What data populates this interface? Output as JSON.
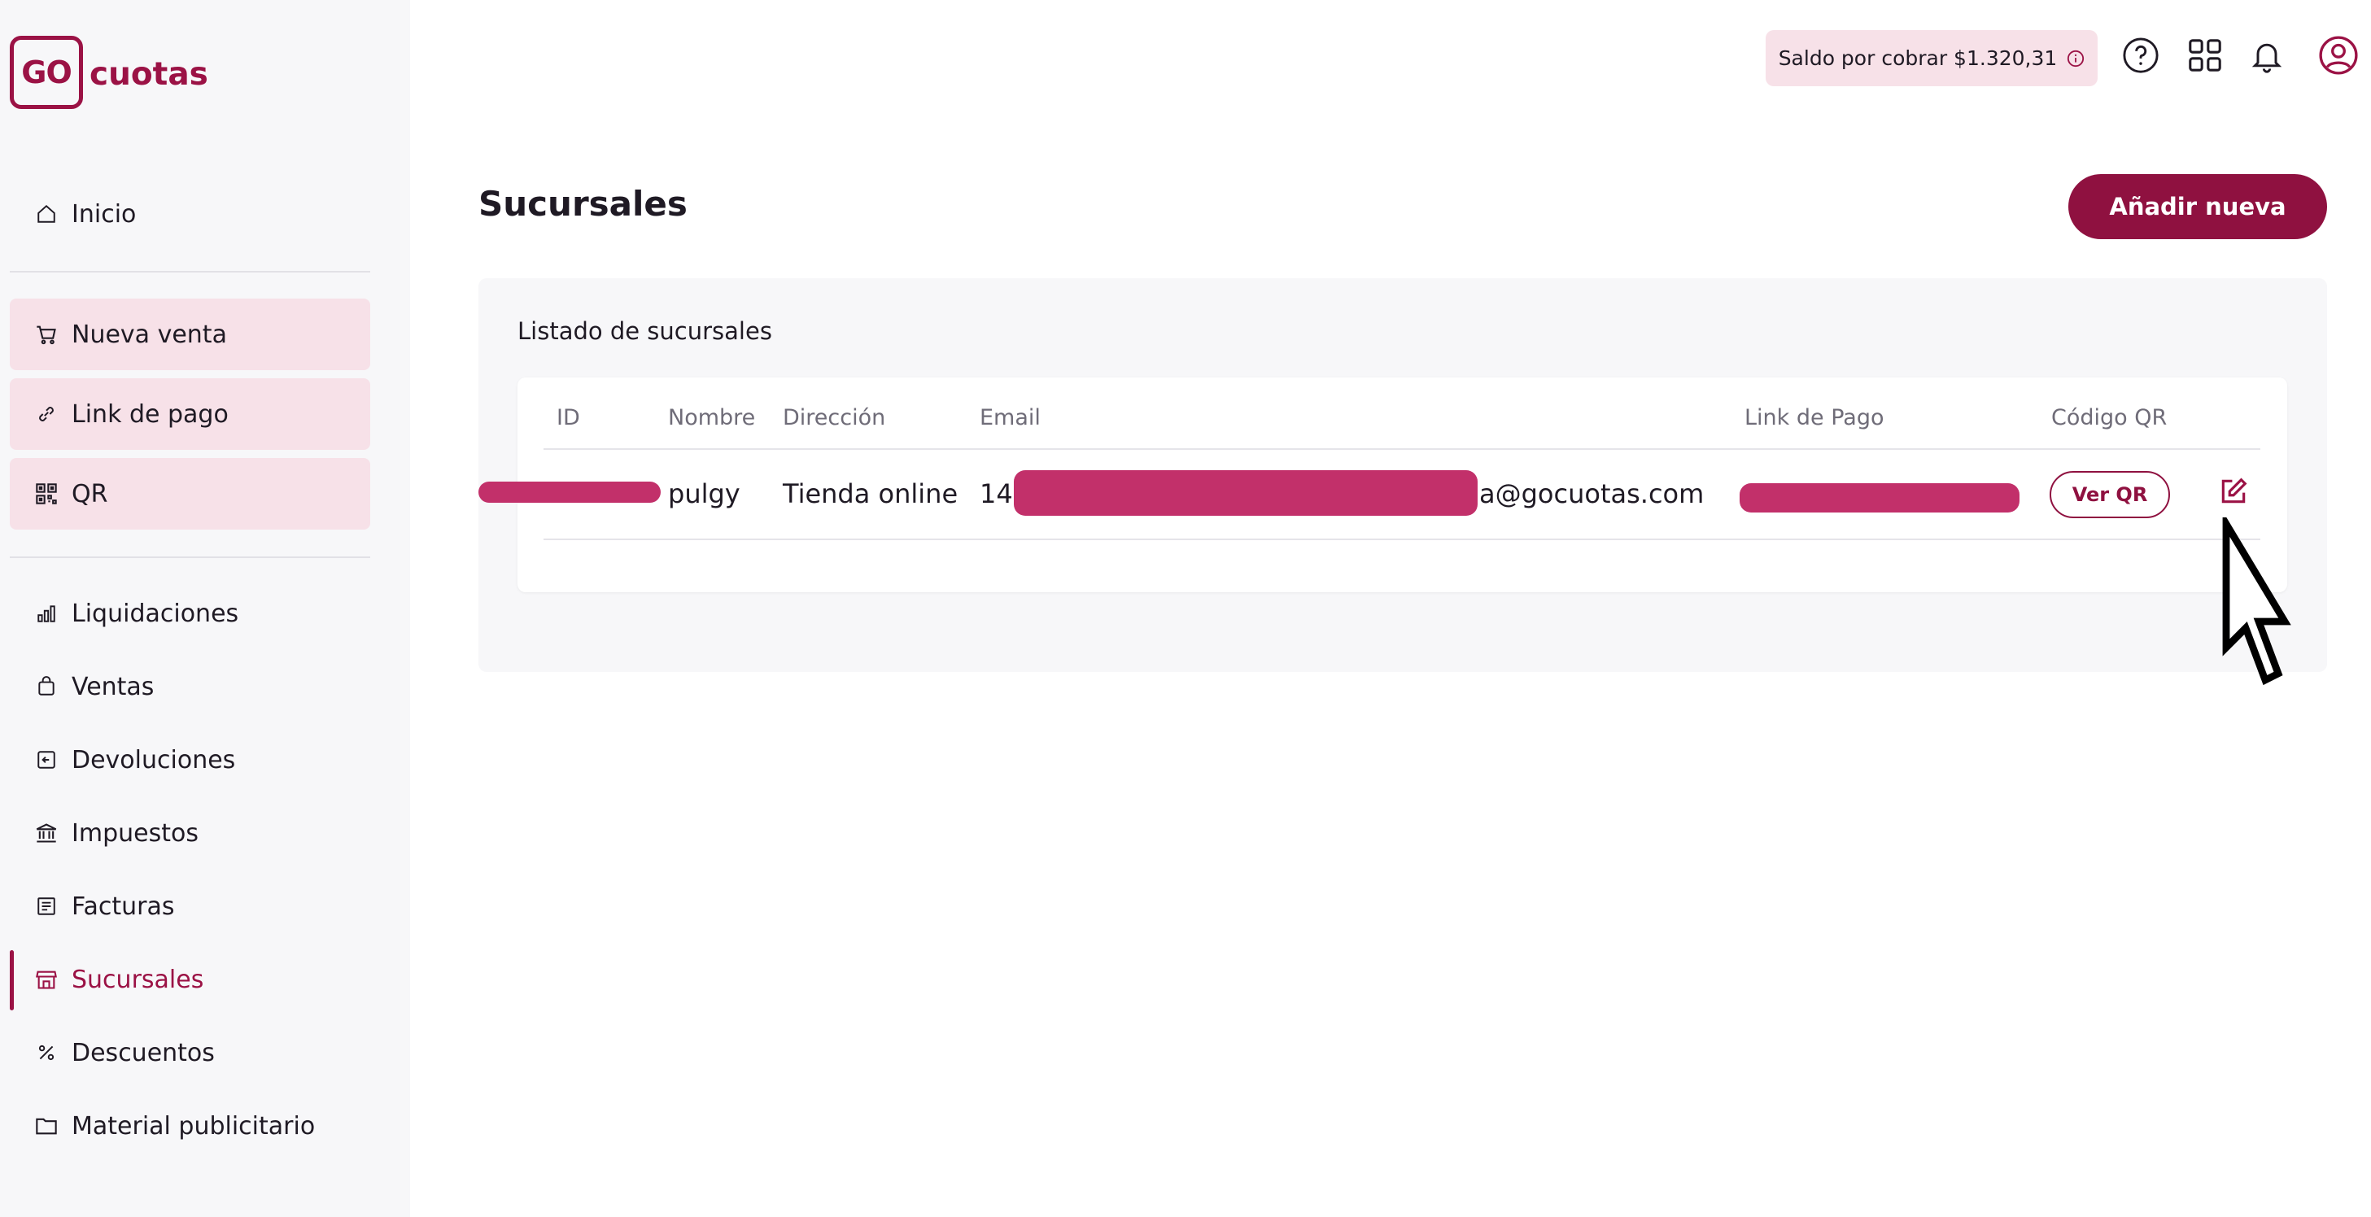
{
  "brand": {
    "logo_box": "GO",
    "logo_text": "cuotas",
    "color": "#9b1245"
  },
  "sidebar": {
    "items": [
      {
        "label": "Inicio",
        "icon": "home-icon"
      },
      {
        "label": "Nueva venta",
        "icon": "cart-icon"
      },
      {
        "label": "Link de pago",
        "icon": "link-icon"
      },
      {
        "label": "QR",
        "icon": "qr-icon"
      },
      {
        "label": "Liquidaciones",
        "icon": "bar-chart-icon"
      },
      {
        "label": "Ventas",
        "icon": "bag-icon"
      },
      {
        "label": "Devoluciones",
        "icon": "return-icon"
      },
      {
        "label": "Impuestos",
        "icon": "bank-icon"
      },
      {
        "label": "Facturas",
        "icon": "invoice-icon"
      },
      {
        "label": "Sucursales",
        "icon": "store-icon",
        "active": true
      },
      {
        "label": "Descuentos",
        "icon": "percent-icon"
      },
      {
        "label": "Material publicitario",
        "icon": "folder-icon"
      }
    ]
  },
  "header": {
    "saldo_label": "Saldo por cobrar $1.320,31",
    "icons": [
      "help-icon",
      "apps-grid-icon",
      "bell-icon",
      "user-avatar-icon"
    ]
  },
  "main": {
    "title": "Sucursales",
    "add_button": "Añadir nueva",
    "list_title": "Listado de sucursales",
    "columns": [
      "ID",
      "Nombre",
      "Dirección",
      "Email",
      "Link de Pago",
      "Código QR"
    ],
    "rows": [
      {
        "id": "",
        "nombre": "pulgy",
        "direccion": "Tienda online",
        "email_prefix": "142",
        "email_suffix": "a@gocuotas.com",
        "link": "",
        "qr_button": "Ver QR"
      }
    ]
  },
  "colors": {
    "accent": "#8f1140",
    "highlight_bg": "#f7e1e8",
    "redaction": "#c2306a"
  }
}
